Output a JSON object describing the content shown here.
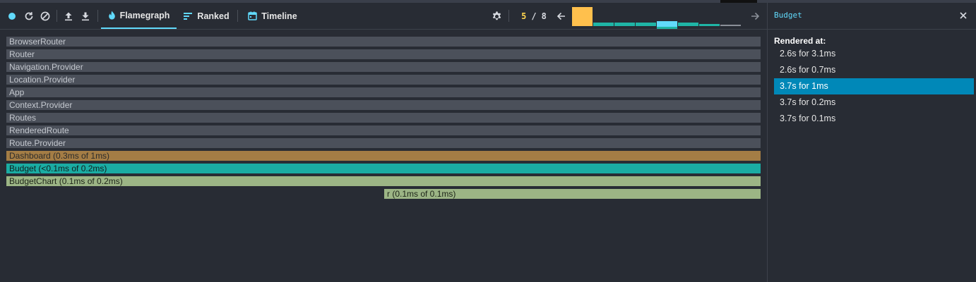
{
  "toolbar": {
    "record_icon": "record-icon",
    "reload_icon": "reload-icon",
    "clear_icon": "clear-icon",
    "load_icon": "upload-icon",
    "save_icon": "download-icon",
    "tabs": [
      {
        "label": "Flamegraph",
        "icon": "flame-icon",
        "active": true
      },
      {
        "label": "Ranked",
        "icon": "ranked-icon",
        "active": false
      },
      {
        "label": "Timeline",
        "icon": "calendar-icon",
        "active": false
      }
    ],
    "settings_icon": "gear-icon",
    "commit": {
      "current": "5",
      "separator": "/",
      "total": "8"
    },
    "prev_icon": "arrow-left-icon",
    "next_icon": "arrow-right-icon"
  },
  "commit_bars": [
    {
      "value": 1.0,
      "color": "#ffc04d",
      "selected_marker": false
    },
    {
      "value": 0.18,
      "color": "#1fb5a6",
      "selected_marker": false
    },
    {
      "value": 0.18,
      "color": "#1fb5a6",
      "selected_marker": false
    },
    {
      "value": 0.2,
      "color": "#1fb5a6",
      "selected_marker": false
    },
    {
      "value": 0.3,
      "color": "#61dafb",
      "selected_marker": true
    },
    {
      "value": 0.18,
      "color": "#1fb5a6",
      "selected_marker": false
    },
    {
      "value": 0.12,
      "color": "#1fb5a6",
      "selected_marker": false
    },
    {
      "value": 0.06,
      "color": "#8a8f98",
      "selected_marker": false
    }
  ],
  "flamegraph": [
    {
      "label": "BrowserRouter",
      "start": 0,
      "end": 1,
      "color": "#4b505a",
      "text": "#c4c8cf"
    },
    {
      "label": "Router",
      "start": 0,
      "end": 1,
      "color": "#4b505a",
      "text": "#c4c8cf"
    },
    {
      "label": "Navigation.Provider",
      "start": 0,
      "end": 1,
      "color": "#4b505a",
      "text": "#c4c8cf"
    },
    {
      "label": "Location.Provider",
      "start": 0,
      "end": 1,
      "color": "#4b505a",
      "text": "#c4c8cf"
    },
    {
      "label": "App",
      "start": 0,
      "end": 1,
      "color": "#4b505a",
      "text": "#c4c8cf"
    },
    {
      "label": "Context.Provider",
      "start": 0,
      "end": 1,
      "color": "#4b505a",
      "text": "#c4c8cf"
    },
    {
      "label": "Routes",
      "start": 0,
      "end": 1,
      "color": "#4b505a",
      "text": "#c4c8cf"
    },
    {
      "label": "RenderedRoute",
      "start": 0,
      "end": 1,
      "color": "#4b505a",
      "text": "#c4c8cf"
    },
    {
      "label": "Route.Provider",
      "start": 0,
      "end": 1,
      "color": "#4b505a",
      "text": "#c4c8cf"
    },
    {
      "label": "Dashboard (0.3ms of 1ms)",
      "start": 0,
      "end": 1,
      "color": "#a47d45",
      "text": "#2b2b2b"
    },
    {
      "label": "Budget (<0.1ms of 0.2ms)",
      "start": 0,
      "end": 1,
      "color": "#1aaca3",
      "text": "#0f1f1f"
    },
    {
      "label": "BudgetChart (0.1ms of 0.2ms)",
      "start": 0,
      "end": 1,
      "color": "#9cb585",
      "text": "#1d2418"
    },
    {
      "label": "r (0.1ms of 0.1ms)",
      "start": 0.5,
      "end": 1,
      "color": "#9cb585",
      "text": "#1d2418"
    }
  ],
  "sidebar": {
    "title": "Budget",
    "close_icon": "close-icon",
    "rendered_label": "Rendered at:",
    "renders": [
      {
        "label": "2.6s for 3.1ms",
        "selected": false
      },
      {
        "label": "2.6s for 0.7ms",
        "selected": false
      },
      {
        "label": "3.7s for 1ms",
        "selected": true
      },
      {
        "label": "3.7s for 0.2ms",
        "selected": false
      },
      {
        "label": "3.7s for 0.1ms",
        "selected": false
      }
    ]
  }
}
